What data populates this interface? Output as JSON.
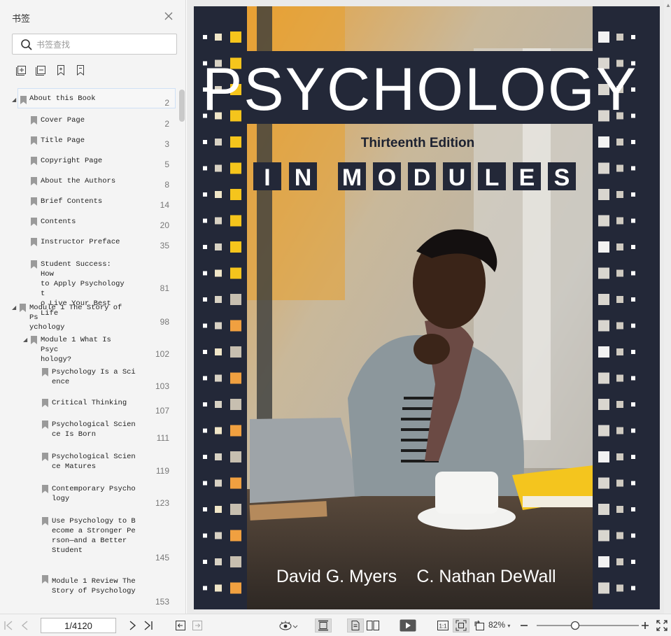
{
  "sidebar": {
    "title": "书签",
    "search_placeholder": "书签查找",
    "bookmarks": [
      {
        "label": "About this Book",
        "page": "2"
      },
      {
        "label": "Cover Page",
        "page": "2"
      },
      {
        "label": "Title Page",
        "page": "3"
      },
      {
        "label": "Copyright Page",
        "page": "5"
      },
      {
        "label": "About the Authors",
        "page": "8"
      },
      {
        "label": "Brief Contents",
        "page": "14"
      },
      {
        "label": "Contents",
        "page": "20"
      },
      {
        "label": "Instructor Preface",
        "page": "35"
      },
      {
        "label": "Student Success: How\nto Apply Psychology t\no Live Your Best Life",
        "page": "81"
      },
      {
        "label": "Module 1 The Story of Ps\nychology",
        "page": "98"
      },
      {
        "label": "Module 1 What Is Psyc\nhology?",
        "page": "102"
      },
      {
        "label": "Psychology Is a Sci\nence",
        "page": "103"
      },
      {
        "label": "Critical Thinking",
        "page": "107"
      },
      {
        "label": "Psychological Scien\nce Is Born",
        "page": "111"
      },
      {
        "label": "Psychological Scien\nce Matures",
        "page": "119"
      },
      {
        "label": "Contemporary Psycho\nlogy",
        "page": "123"
      },
      {
        "label": "Use Psychology to B\necome a Stronger Pe\nrson—and a Better\nStudent",
        "page": "145"
      },
      {
        "label": "Module 1 Review The\nStory of Psychology",
        "page": "153"
      }
    ]
  },
  "cover": {
    "title": "PSYCHOLOGY",
    "edition": "Thirteenth Edition",
    "subtitle_letters": [
      "I",
      "N",
      "M",
      "O",
      "D",
      "U",
      "L",
      "E",
      "S"
    ],
    "author1": "David G. Myers",
    "author2": "C. Nathan DeWall"
  },
  "toolbar": {
    "page_value": "1/4120",
    "zoom": "82%"
  },
  "colors": {
    "cover_bg": "#232838",
    "accent_yellow": "#f5c51c",
    "sidebar_bg": "#f4f4f4"
  }
}
